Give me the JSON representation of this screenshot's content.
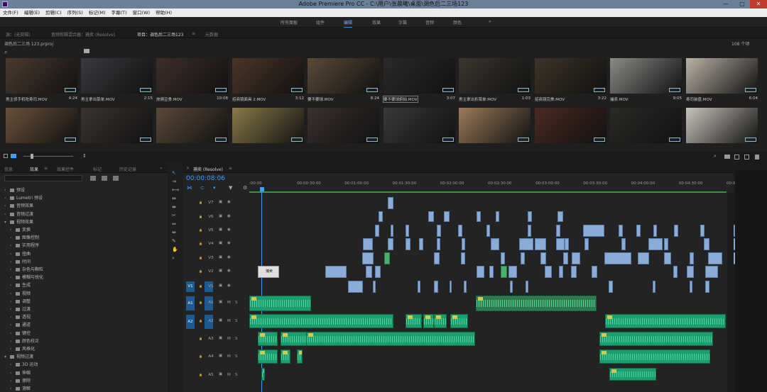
{
  "window": {
    "title": "Adobe Premiere Pro CC - C:\\用户\\张晨曦\\桌面\\调色后二三场123",
    "minimize": "—",
    "maximize": "□",
    "close": "✕"
  },
  "menu": [
    "文件(F)",
    "编辑(E)",
    "剪辑(C)",
    "序列(S)",
    "标记(M)",
    "字幕(T)",
    "窗口(W)",
    "帮助(H)"
  ],
  "workspaces": {
    "items": [
      "所有面板",
      "组件",
      "编辑",
      "效果",
      "字幕",
      "音频",
      "颜色"
    ],
    "active_index": 2,
    "more": "»"
  },
  "source_panel": {
    "tabs": [
      "源：(无剪辑)",
      "音频剪辑混合器：捕卖 (Resolve)",
      "项目：调色后二三场123",
      "元数据"
    ],
    "active_index": 2,
    "menu_icon": "≡",
    "more": "»"
  },
  "project": {
    "path": "调色后二三场 123.prproj",
    "item_count": "108 个项",
    "search_icon": "search-icon",
    "folder_icon": "new-bin-icon",
    "clips": [
      {
        "name": "男主侦手机吃寿司.MOV",
        "duration": "4:24",
        "color": "#4a3a30"
      },
      {
        "name": "男主拿出菜单.MOV",
        "duration": "2:15",
        "color": "#3a3a3e"
      },
      {
        "name": "放俩豆食.MOV",
        "duration": "10:08",
        "color": "#3d2e2a"
      },
      {
        "name": "招商镜面具 2.MOV",
        "duration": "3:12",
        "color": "#4a3528"
      },
      {
        "name": "要不要球.MOV",
        "duration": "8:24",
        "color": "#5a4a38"
      },
      {
        "name": "要不要球俯拍.MOV",
        "duration": "3:07",
        "color": "#2a2a2a"
      },
      {
        "name": "男主拿出折菜单.MOV",
        "duration": "1:03",
        "color": "#3a3630"
      },
      {
        "name": "招商镜完美.MOV",
        "duration": "3:22",
        "color": "#3c3428"
      },
      {
        "name": "捕卖.MOV",
        "duration": "9:05",
        "color": "#8a8a88"
      },
      {
        "name": "寿司装盘.MOV",
        "duration": "6:04",
        "color": "#b9b2a6"
      },
      {
        "name": "",
        "duration": "",
        "color": "#6a5038"
      },
      {
        "name": "",
        "duration": "",
        "color": "#3a3430"
      },
      {
        "name": "",
        "duration": "",
        "color": "#5a4838"
      },
      {
        "name": "",
        "duration": "",
        "color": "#8a7a4a"
      },
      {
        "name": "",
        "duration": "",
        "color": "#3a3030"
      },
      {
        "name": "",
        "duration": "",
        "color": "#3a3838"
      },
      {
        "name": "",
        "duration": "",
        "color": "#9a7a58"
      },
      {
        "name": "",
        "duration": "",
        "color": "#4a2a22"
      },
      {
        "name": "",
        "duration": "",
        "color": "#2a2a28"
      },
      {
        "name": "",
        "duration": "",
        "color": "#c8c4bc"
      }
    ],
    "footer": {
      "list_view": "list-view-icon",
      "icon_view": "icon-view-icon",
      "zoom": "zoom-slider",
      "sort": "sort-icon",
      "find": "find-icon",
      "new_bin": "new-bin-icon",
      "new_item": "new-item-icon",
      "delete": "trash-icon"
    }
  },
  "effects_panel": {
    "tabs": [
      "信息",
      "效果",
      "效果控件",
      "标记",
      "历史记录"
    ],
    "active_index": 1,
    "menu_icon": "≡",
    "more": "»",
    "tree": [
      {
        "label": "预设",
        "depth": 0,
        "open": false
      },
      {
        "label": "Lumetri 预设",
        "depth": 0,
        "open": false
      },
      {
        "label": "音频效果",
        "depth": 0,
        "open": false
      },
      {
        "label": "音频过渡",
        "depth": 0,
        "open": false
      },
      {
        "label": "视频效果",
        "depth": 0,
        "open": true
      },
      {
        "label": "变换",
        "depth": 1,
        "open": false
      },
      {
        "label": "图像控制",
        "depth": 1,
        "open": false
      },
      {
        "label": "实用程序",
        "depth": 1,
        "open": false
      },
      {
        "label": "扭曲",
        "depth": 1,
        "open": false
      },
      {
        "label": "时间",
        "depth": 1,
        "open": false
      },
      {
        "label": "杂色与颗粒",
        "depth": 1,
        "open": false
      },
      {
        "label": "模糊与锐化",
        "depth": 1,
        "open": false
      },
      {
        "label": "生成",
        "depth": 1,
        "open": false
      },
      {
        "label": "视频",
        "depth": 1,
        "open": false
      },
      {
        "label": "调整",
        "depth": 1,
        "open": false
      },
      {
        "label": "过渡",
        "depth": 1,
        "open": false
      },
      {
        "label": "透视",
        "depth": 1,
        "open": false
      },
      {
        "label": "通道",
        "depth": 1,
        "open": false
      },
      {
        "label": "键控",
        "depth": 1,
        "open": false
      },
      {
        "label": "颜色校正",
        "depth": 1,
        "open": false
      },
      {
        "label": "风格化",
        "depth": 1,
        "open": false
      },
      {
        "label": "视频过渡",
        "depth": 0,
        "open": true
      },
      {
        "label": "3D 运动",
        "depth": 1,
        "open": false
      },
      {
        "label": "伸缩",
        "depth": 1,
        "open": false
      },
      {
        "label": "擦除",
        "depth": 1,
        "open": false
      },
      {
        "label": "溶解",
        "depth": 1,
        "open": false
      }
    ]
  },
  "timeline": {
    "sequence_tab": "捕卖 (Resolve)",
    "close_icon": "×",
    "menu_icon": "≡",
    "timecode": "00:00:08:06",
    "ruler": [
      ":00:00",
      "00:00:30:00",
      "00:01:00:00",
      "00:01:30:00",
      "00:02:00:00",
      "00:02:30:00",
      "00:03:00:00",
      "00:03:30:00",
      "00:04:00:00",
      "00:04:30:00",
      "00:05:"
    ],
    "video_tracks": [
      "V7",
      "V6",
      "V5",
      "V4",
      "V3",
      "V2",
      "V1"
    ],
    "audio_tracks": [
      "A1",
      "A2",
      "A3",
      "A4",
      "A5"
    ],
    "source_patch": {
      "video": "V1",
      "audio": [
        "A1",
        "A2"
      ]
    },
    "mute": "M",
    "solo": "S",
    "clip_label": "捕卖"
  }
}
